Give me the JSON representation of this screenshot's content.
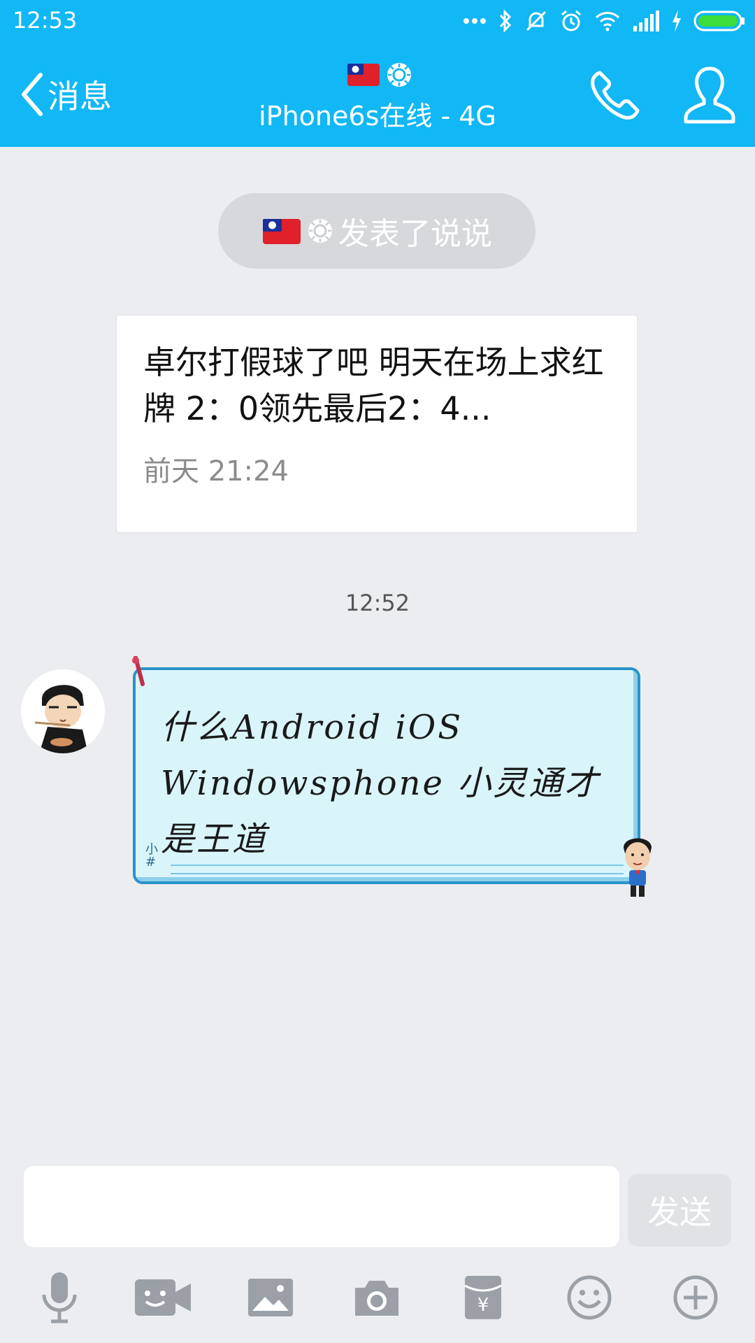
{
  "status_bar": {
    "time": "12:53"
  },
  "header": {
    "back_label": "消息",
    "title_emoji": "🇹🇼🔆",
    "subtitle": "iPhone6s在线 - 4G"
  },
  "notice": {
    "text": "发表了说说"
  },
  "feed_card": {
    "text": "卓尔打假球了吧 明天在场上求红牌 2：0领先最后2：4...",
    "time": "前天 21:24"
  },
  "chat": {
    "timestamp": "12:52",
    "message": "什么Android iOS Windowsphone 小灵通才是王道",
    "bubble_tag": "小#"
  },
  "input": {
    "placeholder": "",
    "value": "",
    "send_label": "发送"
  },
  "toolbar": {
    "icons": [
      "microphone-icon",
      "video-call-icon",
      "image-icon",
      "camera-icon",
      "red-packet-icon",
      "emoji-icon",
      "plus-icon"
    ]
  },
  "colors": {
    "accent": "#12b7f5",
    "background": "#ebedf0",
    "bubble_fill": "#d9f5fa",
    "bubble_border": "#2a93c8",
    "toolbar_icon": "#9aa0a6"
  }
}
